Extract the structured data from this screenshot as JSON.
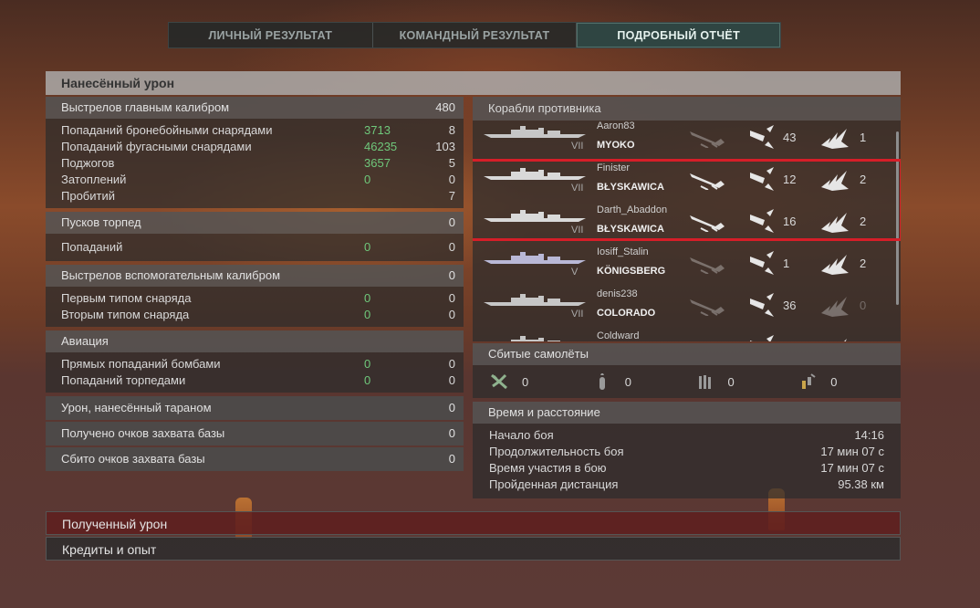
{
  "tabs": [
    "ЛИЧНЫЙ РЕЗУЛЬТАТ",
    "КОМАНДНЫЙ РЕЗУЛЬТАТ",
    "ПОДРОБНЫЙ ОТЧЁТ"
  ],
  "damage_header": "Нанесённый урон",
  "main_battery": {
    "title": "Выстрелов главным калибром",
    "value": "480",
    "rows": [
      {
        "label": "Попаданий бронебойными снарядами",
        "green": "3713",
        "value": "8"
      },
      {
        "label": "Попаданий фугасными снарядами",
        "green": "46235",
        "value": "103"
      },
      {
        "label": "Поджогов",
        "green": "3657",
        "value": "5"
      },
      {
        "label": "Затоплений",
        "green": "0",
        "value": "0"
      },
      {
        "label": "Пробитий",
        "green": "",
        "value": "7"
      }
    ]
  },
  "torpedoes": {
    "title": "Пусков торпед",
    "value": "0",
    "rows": [
      {
        "label": "Попаданий",
        "green": "0",
        "value": "0"
      }
    ]
  },
  "secondary": {
    "title": "Выстрелов вспомогательным калибром",
    "value": "0",
    "rows": [
      {
        "label": "Первым типом снаряда",
        "green": "0",
        "value": "0"
      },
      {
        "label": "Вторым типом снаряда",
        "green": "0",
        "value": "0"
      }
    ]
  },
  "aviation": {
    "title": "Авиация",
    "rows": [
      {
        "label": "Прямых попаданий бомбами",
        "green": "0",
        "value": "0"
      },
      {
        "label": "Попаданий торпедами",
        "green": "0",
        "value": "0"
      }
    ]
  },
  "ram": {
    "label": "Урон, нанесённый тараном",
    "value": "0"
  },
  "cap_points": {
    "label": "Получено очков захвата базы",
    "value": "0"
  },
  "cap_reset": {
    "label": "Сбито очков захвата базы",
    "value": "0"
  },
  "enemy_ships": {
    "title": "Корабли противника",
    "ships": [
      {
        "player": "Aaron83",
        "tier": "VII",
        "name": "MYOKO",
        "hits": "43",
        "kills": "1"
      },
      {
        "player": "Finister",
        "tier": "VII",
        "name": "BŁYSKAWICA",
        "hits": "12",
        "kills": "2"
      },
      {
        "player": "Darth_Abaddon",
        "tier": "VII",
        "name": "BŁYSKAWICA",
        "hits": "16",
        "kills": "2"
      },
      {
        "player": "Iosiff_Stalin",
        "tier": "V",
        "name": "KÖNIGSBERG",
        "hits": "1",
        "kills": "2"
      },
      {
        "player": "denis238",
        "tier": "VII",
        "name": "COLORADO",
        "hits": "36",
        "kills": "0"
      },
      {
        "player": "Coldward",
        "tier": "",
        "name": "",
        "hits": "",
        "kills": ""
      }
    ]
  },
  "planes": {
    "title": "Сбитые самолёты",
    "counts": [
      "0",
      "0",
      "0",
      "0"
    ],
    "icons": [
      "fighter-icon",
      "bomber-icon",
      "torpedo-bomber-icon",
      "dive-bomber-icon"
    ]
  },
  "time": {
    "title": "Время и расстояние",
    "rows": [
      {
        "label": "Начало боя",
        "value": "14:16"
      },
      {
        "label": "Продолжительность боя",
        "value": "17 мин 07 с"
      },
      {
        "label": "Время участия в бою",
        "value": "17 мин 07 с"
      },
      {
        "label": "Пройденная дистанция",
        "value": "95.38 км"
      }
    ]
  },
  "received_damage": "Полученный урон",
  "credits_xp": "Кредиты и опыт",
  "colors": {
    "accent": "#6fc87b",
    "highlight": "#d61e28",
    "active_tab": "#2f4542"
  }
}
